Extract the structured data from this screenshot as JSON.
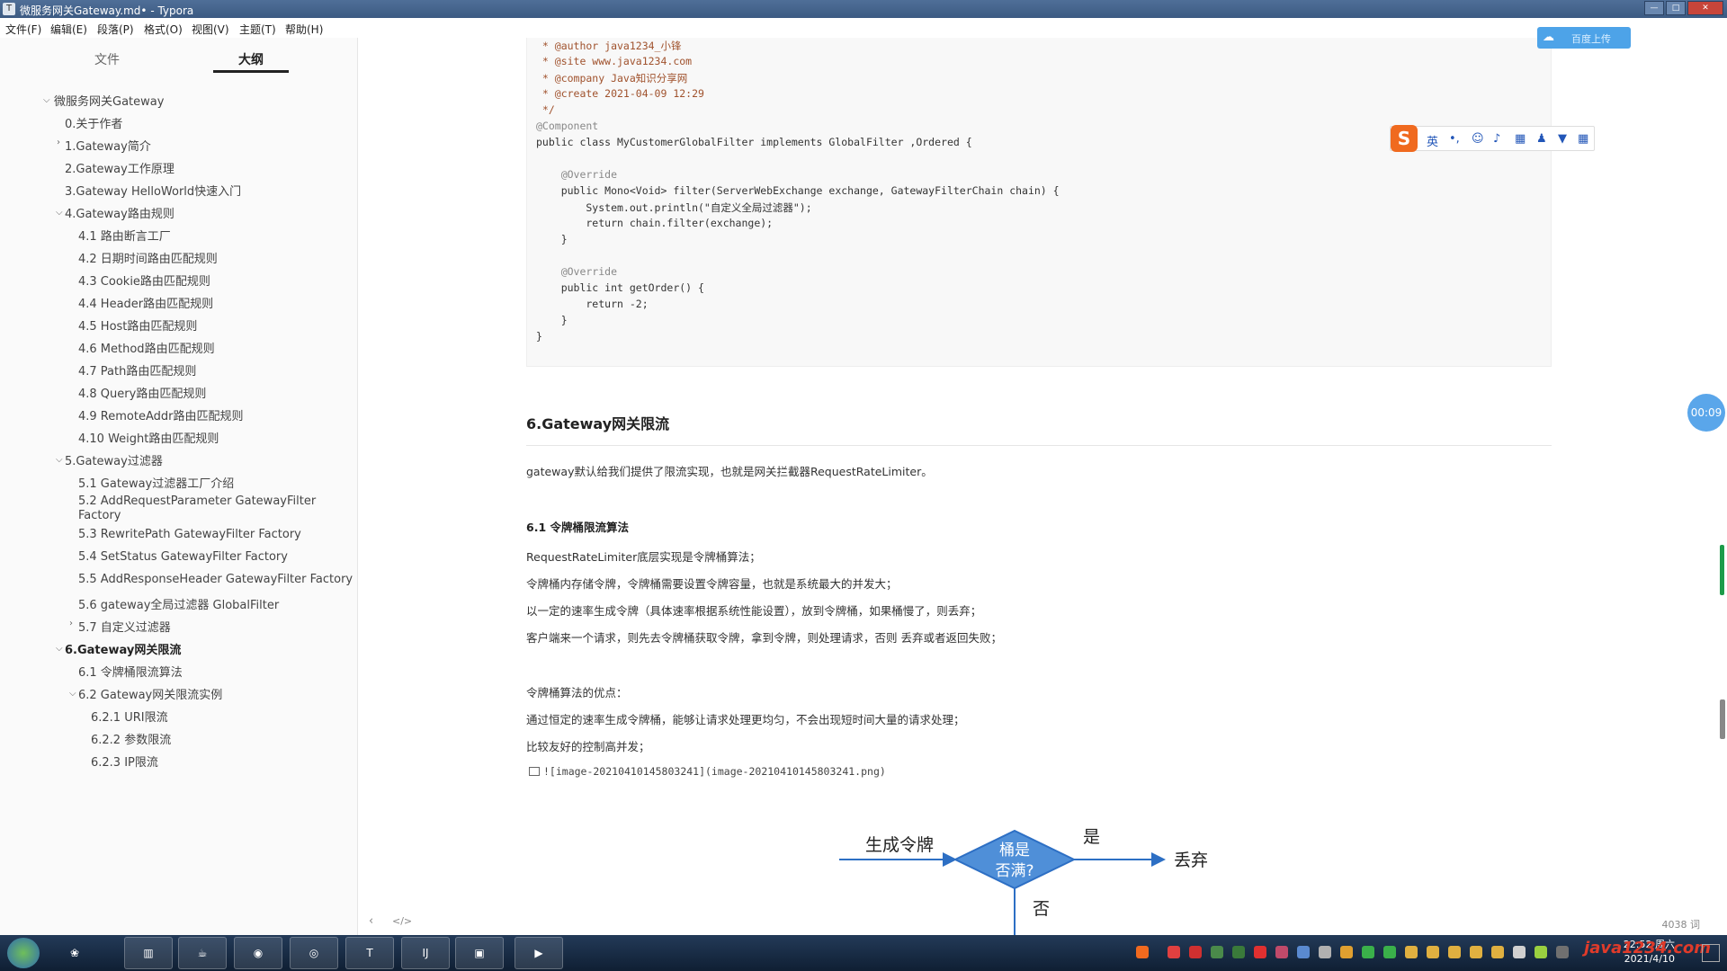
{
  "window": {
    "title": "微服务网关Gateway.md• - Typora",
    "app_icon": "T"
  },
  "menu": [
    "文件(F)",
    "编辑(E)",
    "段落(P)",
    "格式(O)",
    "视图(V)",
    "主题(T)",
    "帮助(H)"
  ],
  "sidebar": {
    "tabs": [
      "文件",
      "大纲"
    ],
    "active_tab": "大纲",
    "outline": [
      {
        "label": "微服务网关Gateway",
        "level": 0,
        "expanded": true
      },
      {
        "label": "0.关于作者",
        "level": 1
      },
      {
        "label": "1.Gateway简介",
        "level": 1,
        "collapsed": true
      },
      {
        "label": "2.Gateway工作原理",
        "level": 1
      },
      {
        "label": "3.Gateway HelloWorld快速入门",
        "level": 1
      },
      {
        "label": "4.Gateway路由规则",
        "level": 1,
        "expanded": true
      },
      {
        "label": "4.1 路由断言工厂",
        "level": 2
      },
      {
        "label": "4.2 日期时间路由匹配规则",
        "level": 2
      },
      {
        "label": "4.3 Cookie路由匹配规则",
        "level": 2
      },
      {
        "label": "4.4 Header路由匹配规则",
        "level": 2
      },
      {
        "label": "4.5 Host路由匹配规则",
        "level": 2
      },
      {
        "label": "4.6 Method路由匹配规则",
        "level": 2
      },
      {
        "label": "4.7 Path路由匹配规则",
        "level": 2
      },
      {
        "label": "4.8 Query路由匹配规则",
        "level": 2
      },
      {
        "label": "4.9 RemoteAddr路由匹配规则",
        "level": 2
      },
      {
        "label": "4.10 Weight路由匹配规则",
        "level": 2
      },
      {
        "label": "5.Gateway过滤器",
        "level": 1,
        "expanded": true
      },
      {
        "label": "5.1 Gateway过滤器工厂介绍",
        "level": 2
      },
      {
        "label": "5.2 AddRequestParameter GatewayFilter",
        "level": 2
      },
      {
        "label": "Factory",
        "level": 2
      },
      {
        "label": "5.3 RewritePath GatewayFilter Factory",
        "level": 2
      },
      {
        "label": "5.4 SetStatus GatewayFilter Factory",
        "level": 2
      },
      {
        "label": "5.5 AddResponseHeader GatewayFilter Factory",
        "level": 2
      },
      {
        "label": "5.6 gateway全局过滤器 GlobalFilter",
        "level": 2
      },
      {
        "label": "5.7 自定义过滤器",
        "level": 2,
        "collapsed": true
      },
      {
        "label": "6.Gateway网关限流",
        "level": 1,
        "expanded": true,
        "active": true
      },
      {
        "label": "6.1 令牌桶限流算法",
        "level": 2
      },
      {
        "label": "6.2 Gateway网关限流实例",
        "level": 2,
        "expanded": true
      },
      {
        "label": "6.2.1 URI限流",
        "level": 3
      },
      {
        "label": "6.2.2 参数限流",
        "level": 3
      },
      {
        "label": "6.2.3 IP限流",
        "level": 3
      }
    ]
  },
  "code": {
    "lines": [
      " * @author java1234_小锋",
      " * @site www.java1234.com",
      " * @company Java知识分享网",
      " * @create 2021-04-09 12:29",
      " */",
      "@Component",
      "public class MyCustomerGlobalFilter implements GlobalFilter ,Ordered {",
      "",
      "    @Override",
      "    public Mono<Void> filter(ServerWebExchange exchange, GatewayFilterChain chain) {",
      "        System.out.println(\"自定义全局过滤器\");",
      "        return chain.filter(exchange);",
      "    }",
      "",
      "    @Override",
      "    public int getOrder() {",
      "        return -2;",
      "    }",
      "}"
    ]
  },
  "content": {
    "h2": "6.Gateway网关限流",
    "p1": "gateway默认给我们提供了限流实现，也就是网关拦截器RequestRateLimiter。",
    "h3": "6.1 令牌桶限流算法",
    "p2": "RequestRateLimiter底层实现是令牌桶算法；",
    "p3": "令牌桶内存储令牌，令牌桶需要设置令牌容量，也就是系统最大的并发大；",
    "p4": "以一定的速率生成令牌（具体速率根据系统性能设置），放到令牌桶，如果桶慢了，则丢弃；",
    "p5": "客户端来一个请求，则先去令牌桶获取令牌，拿到令牌，则处理请求，否则 丢弃或者返回失败；",
    "p6": "令牌桶算法的优点：",
    "p7": "通过恒定的速率生成令牌桶，能够让请求处理更均匀，不会出现短时间大量的请求处理；",
    "p8": "比较友好的控制高并发；",
    "image_ref": "![image-20210410145803241](image-20210410145803241.png)",
    "flow": {
      "generate": "生成令牌",
      "diamond_line1": "桶是",
      "diamond_line2": "否满?",
      "yes": "是",
      "discard": "丢弃",
      "no": "否"
    }
  },
  "footer": {
    "back": "‹",
    "source": "</>",
    "word_count": "4038 词"
  },
  "widgets": {
    "cloud_badge_icon": "cloud-icon",
    "cloud_badge_text": "百度上传",
    "ime_glyphs": [
      "英",
      "•,",
      "☺",
      "♪",
      "▦",
      "♟",
      "▼",
      "▦"
    ],
    "timer": "00:09"
  },
  "taskbar": {
    "apps": [
      "chart-app-icon",
      "java-app-icon",
      "browser-icon",
      "chrome-icon",
      "T",
      "IJ",
      "folder-icon",
      "media-icon"
    ],
    "time": "22:52 周六",
    "date": "2021/4/10",
    "watermark": "java1234.com"
  },
  "colors": {
    "accent": "#4f8fd8",
    "diamond": "#4f8fd8",
    "arrow": "#2d6fc4"
  }
}
